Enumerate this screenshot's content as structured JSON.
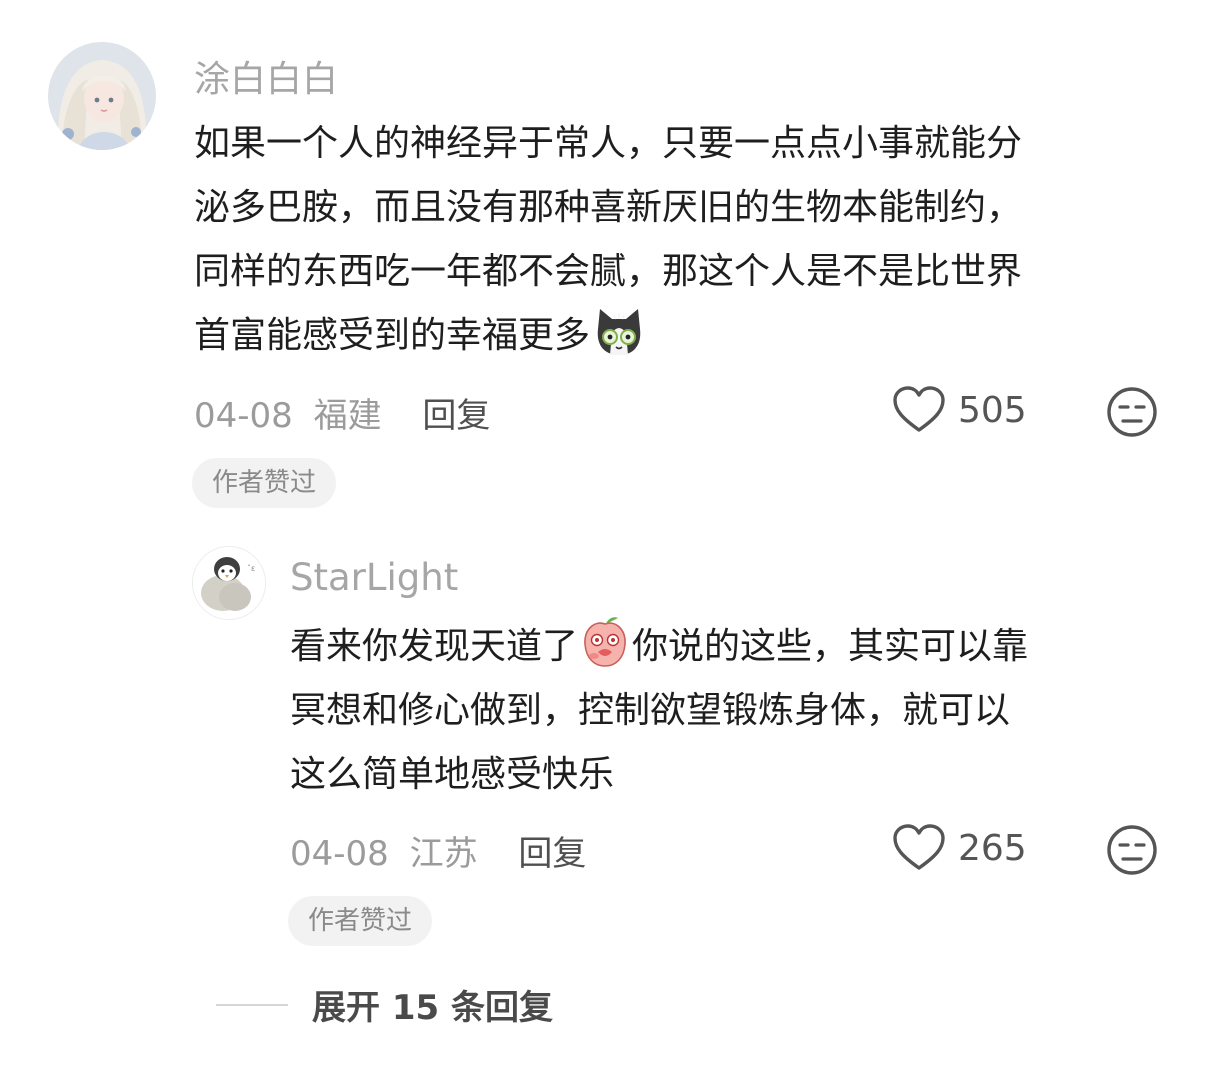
{
  "comment": {
    "username": "涂白白白",
    "lines": [
      "如果一个人的神经异于常人，只要一点点小事就能分",
      "泌多巴胺，而且没有那种喜新厌旧的生物本能制约，",
      "同样的东西吃一年都不会腻，那这个人是不是比世界",
      "首富能感受到的幸福更多"
    ],
    "date": "04-08",
    "location": "福建",
    "reply_label": "回复",
    "likes": "505",
    "badge": "作者赞过",
    "avatar_icon": "girl-avatar",
    "emoji_icon": "cat-emoji"
  },
  "reply": {
    "username": "StarLight",
    "line1_before": "看来你发现天道了",
    "line1_after": "你说的这些，其实可以靠",
    "lines_rest": [
      "冥想和修心做到，控制欲望锻炼身体，就可以",
      "这么简单地感受快乐"
    ],
    "date": "04-08",
    "location": "江苏",
    "reply_label": "回复",
    "likes": "265",
    "badge": "作者赞过",
    "avatar_icon": "penguin-avatar",
    "emoji_icon": "peach-emoji"
  },
  "expand_label": "展开 15 条回复"
}
